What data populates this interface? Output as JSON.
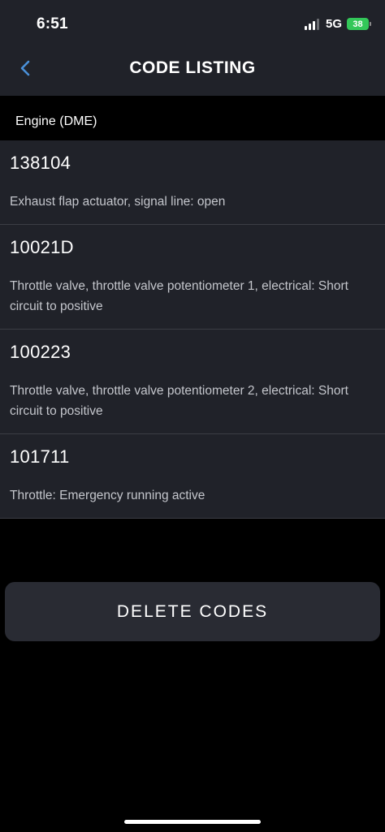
{
  "status_bar": {
    "time": "6:51",
    "network": "5G",
    "battery": "38"
  },
  "header": {
    "title": "CODE LISTING"
  },
  "section": {
    "label": "Engine (DME)"
  },
  "codes": [
    {
      "code": "138104",
      "description": "Exhaust flap actuator, signal line: open"
    },
    {
      "code": "10021D",
      "description": "Throttle valve, throttle valve potentiometer 1, electrical: Short circuit to positive"
    },
    {
      "code": "100223",
      "description": "Throttle valve, throttle valve potentiometer 2, electrical: Short circuit to positive"
    },
    {
      "code": "101711",
      "description": "Throttle: Emergency running active"
    }
  ],
  "actions": {
    "delete_label": "DELETE CODES"
  },
  "colors": {
    "accent": "#4a90d9",
    "battery": "#33c759",
    "panel": "#202229"
  }
}
